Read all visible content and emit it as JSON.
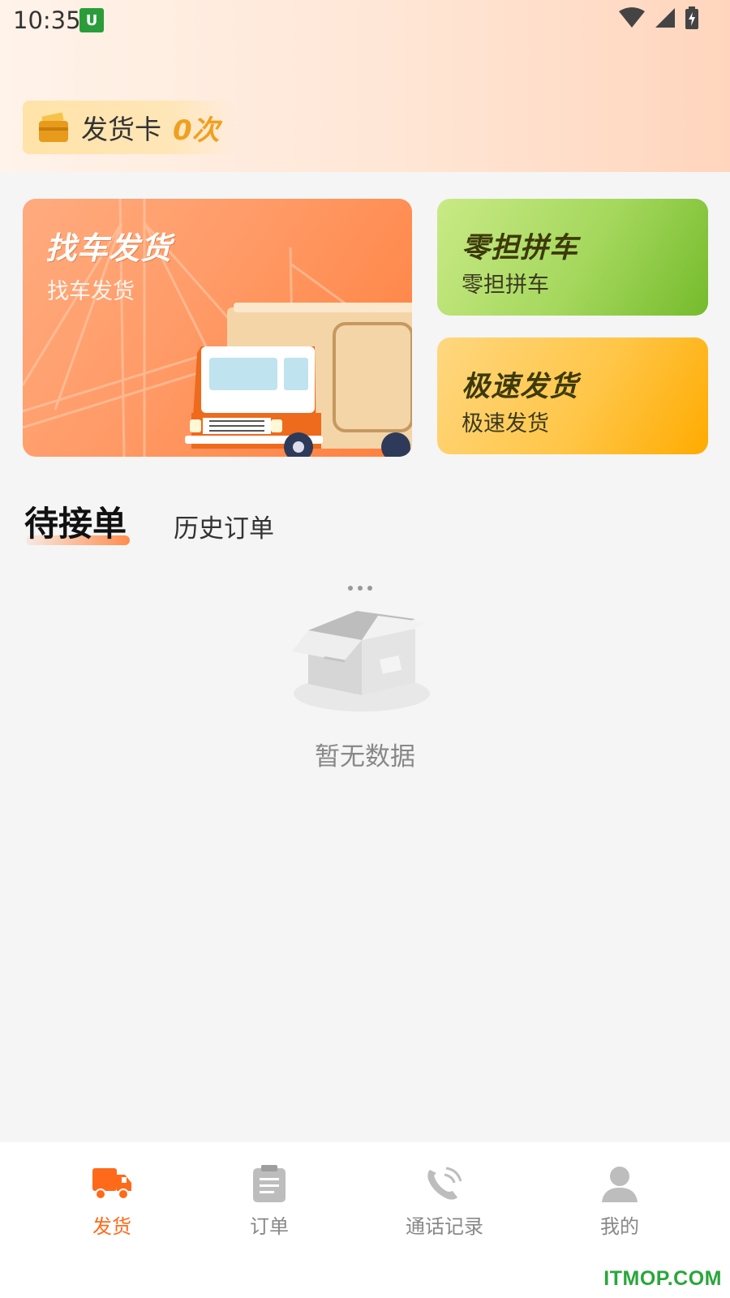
{
  "status_bar": {
    "time": "10:35",
    "notify_badge": "U"
  },
  "delivery_card": {
    "label": "发货卡",
    "count": "0次"
  },
  "tiles": {
    "main": {
      "title": "找车发货",
      "subtitle": "找车发货"
    },
    "ltl": {
      "title": "零担拼车",
      "subtitle": "零担拼车"
    },
    "express": {
      "title": "极速发货",
      "subtitle": "极速发货"
    }
  },
  "tabs": {
    "active": "待接单",
    "other": "历史订单"
  },
  "empty_state": {
    "text": "暂无数据"
  },
  "bottom_nav": [
    {
      "label": "发货",
      "icon": "truck-icon",
      "active": true
    },
    {
      "label": "订单",
      "icon": "clipboard-icon",
      "active": false
    },
    {
      "label": "通话记录",
      "icon": "phone-icon",
      "active": false
    },
    {
      "label": "我的",
      "icon": "person-icon",
      "active": false
    }
  ],
  "watermark": "ITMOP.COM",
  "colors": {
    "accent": "#ff6a1a",
    "nav_inactive": "#888888",
    "green_tile": "#a4d75c",
    "yellow_tile": "#ffc648"
  }
}
